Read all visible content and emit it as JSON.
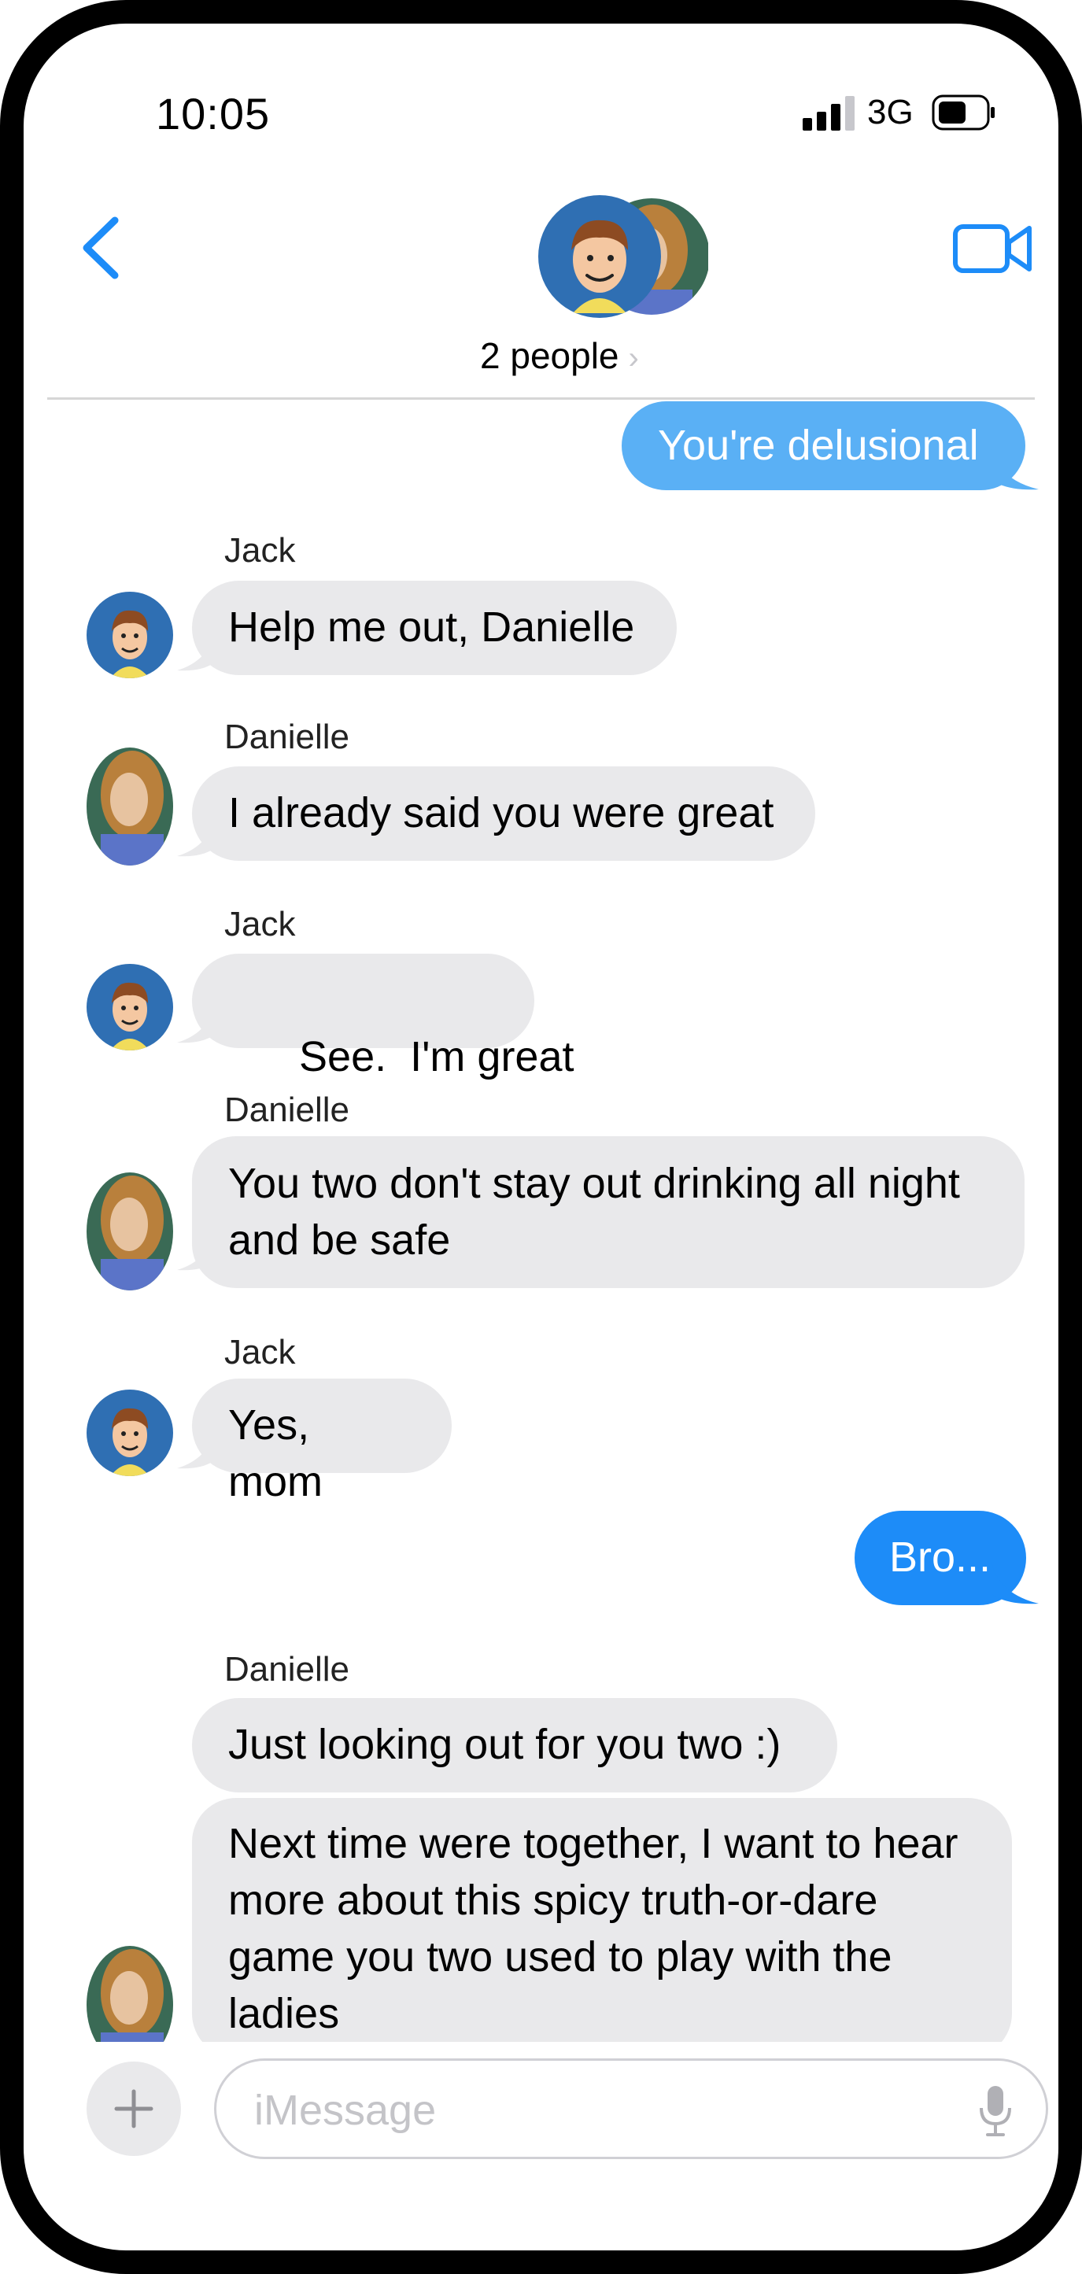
{
  "status_bar": {
    "time": "10:05",
    "network": "3G"
  },
  "header": {
    "people_label": "2 people",
    "chevron": "›"
  },
  "messages": [
    {
      "text": "You're delusional"
    },
    {
      "sender": "Jack",
      "text": "Help me out, Danielle"
    },
    {
      "sender": "Danielle",
      "text": "I already said you were great"
    },
    {
      "sender": "Jack",
      "text": "See.  I'm great"
    },
    {
      "sender": "Danielle",
      "line1": "You two don't stay out drinking all night",
      "line2": "and be safe"
    },
    {
      "sender": "Jack",
      "text": "Yes, mom"
    },
    {
      "text": "Bro..."
    },
    {
      "sender": "Danielle",
      "text": "Just looking out for you two :)"
    },
    {
      "line1": "Next time were together, I want to hear",
      "line2": "more about this spicy truth-or-dare",
      "line3": "game you two used to play with the",
      "line4": "ladies"
    }
  ],
  "compose": {
    "placeholder": "iMessage",
    "plus": "+"
  },
  "colors": {
    "accent": "#1d8cf8",
    "accent_light": "#5ab0f5",
    "bubble_in": "#e9e9eb"
  }
}
